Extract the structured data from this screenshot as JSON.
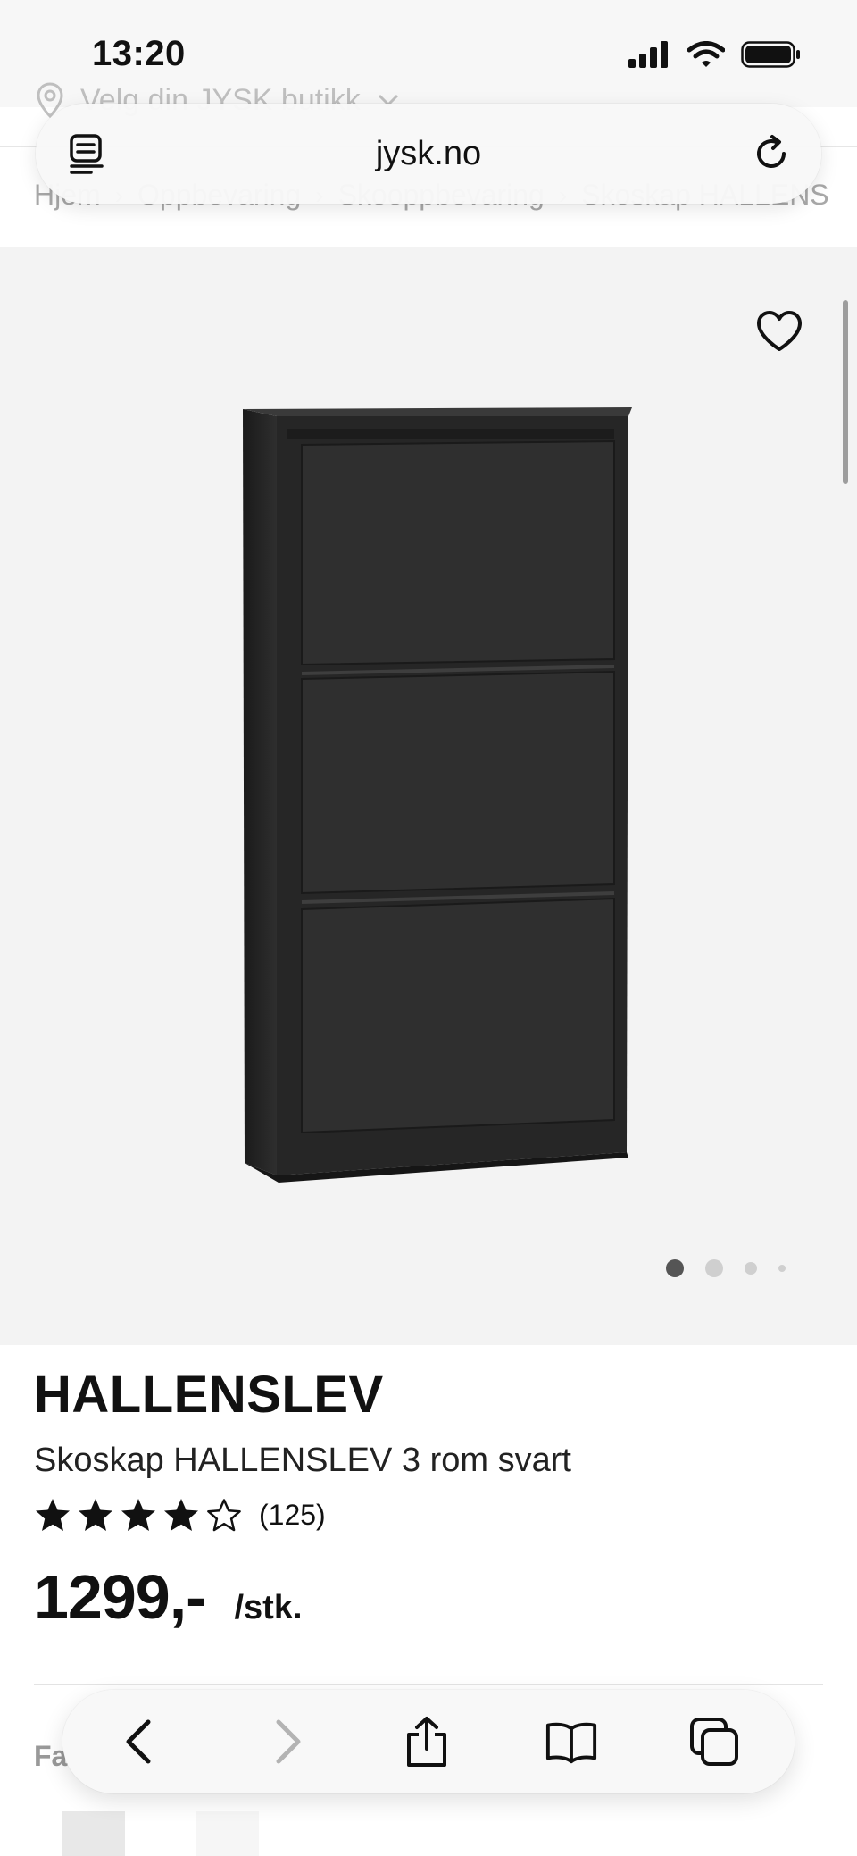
{
  "status_bar": {
    "time": "13:20"
  },
  "header": {
    "store_selector": "Velg din JYSK butikk",
    "url": "jysk.no",
    "breadcrumb": [
      "Hjem",
      "Oppbevaring",
      "Skooppbevaring",
      "Skoskap HALLENS"
    ]
  },
  "gallery": {
    "image_count": 4,
    "active_index": 0
  },
  "product": {
    "brand": "HALLENSLEV",
    "name": "Skoskap HALLENSLEV 3 rom svart",
    "rating": 4,
    "rating_max": 5,
    "review_count": "(125)",
    "price": "1299,-",
    "unit": "/stk.",
    "color_label": "Fa"
  },
  "icons": {
    "signal": "cellular-signal-icon",
    "wifi": "wifi-icon",
    "battery": "battery-icon",
    "location": "location-pin-icon",
    "reader": "reader-mode-icon",
    "reload": "reload-icon",
    "favorite": "heart-icon",
    "back": "chevron-left-icon",
    "forward": "chevron-right-icon",
    "share": "share-icon",
    "bookmarks": "book-icon",
    "tabs": "tabs-icon"
  },
  "colors": {
    "product": "#2b2b2b",
    "gallery_bg": "#f3f3f3",
    "text": "#111111"
  }
}
